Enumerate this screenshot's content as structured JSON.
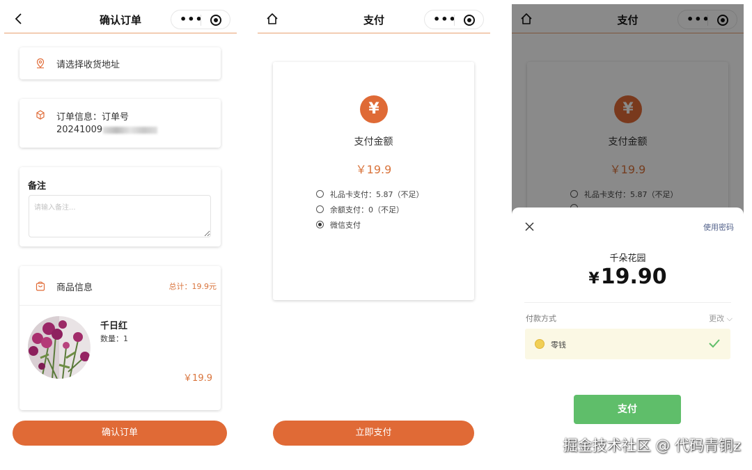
{
  "screen1": {
    "nav_title": "确认订单",
    "address_label": "请选择收货地址",
    "order_info_label": "订单信息：订单号",
    "order_number": "20241009",
    "remark_title": "备注",
    "remark_placeholder": "请输入备注...",
    "goods_header": "商品信息",
    "goods_total": "总计：19.9元",
    "goods_name": "千日红",
    "goods_qty": "数量：1",
    "goods_price": "￥19.9",
    "confirm_button": "确认订单"
  },
  "screen2": {
    "nav_title": "支付",
    "currency_symbol": "¥",
    "pay_label": "支付金额",
    "pay_amount": "￥19.9",
    "options": [
      {
        "label": "礼品卡支付：5.87（不足）",
        "selected": false
      },
      {
        "label": "余额支付：0（不足）",
        "selected": false
      },
      {
        "label": "微信支付",
        "selected": true
      }
    ],
    "pay_now_button": "立即支付"
  },
  "screen3": {
    "nav_title": "支付",
    "currency_symbol": "¥",
    "pay_label": "支付金额",
    "pay_amount": "￥19.9",
    "option_1": "礼品卡支付：5.87（不足）",
    "sheet": {
      "use_password": "使用密码",
      "merchant": "千朵花园",
      "currency": "¥",
      "amount": "19.90",
      "payment_method_label": "付款方式",
      "change_label": "更改 ⌵",
      "method_name": "零钱",
      "pay_button": "支付"
    }
  },
  "watermark": "掘金技术社区 @ 代码青铜z",
  "colors": {
    "accent": "#e06a36",
    "price": "#d9743c",
    "wechat_green": "#5fbe6a",
    "nav_underline": "#e8a070"
  },
  "icons": {
    "nav_back": "chevron-left-icon",
    "nav_home": "home-icon",
    "nav_more": "more-dots-icon",
    "nav_target": "target-icon",
    "address": "location-pin-icon",
    "order": "order-icon",
    "goods": "bag-icon",
    "close": "close-icon",
    "check": "check-icon",
    "coin": "coin-icon"
  }
}
